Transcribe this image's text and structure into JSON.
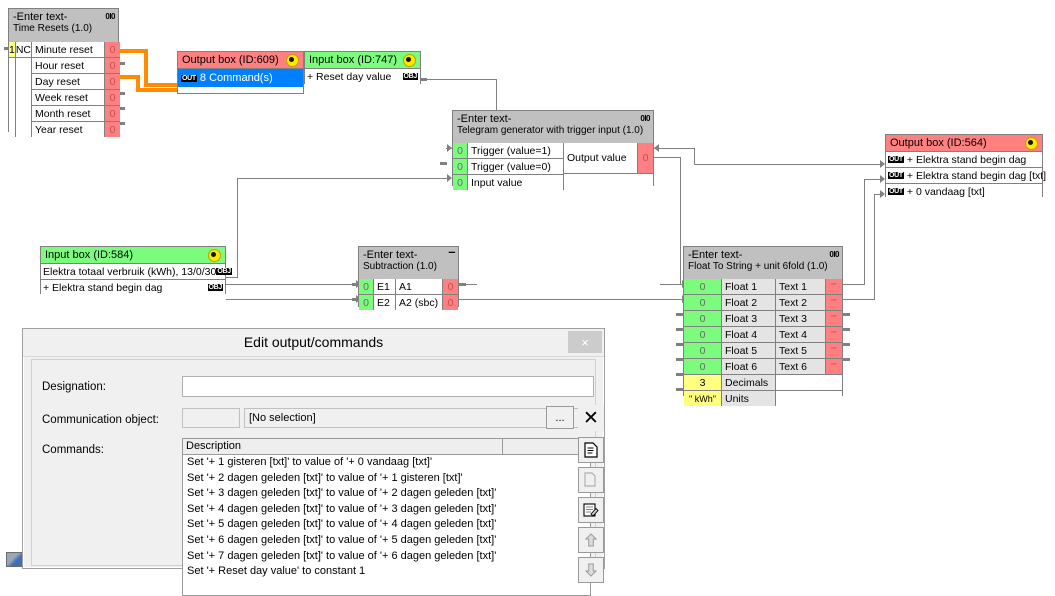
{
  "diagram": {
    "time_resets": {
      "header_line1": "-Enter text-",
      "header_line2": "Time Resets (1.0)",
      "badge": "0I0",
      "input_num": "1",
      "input_nc": "NC",
      "rows": [
        {
          "label": "Minute reset",
          "value": "0"
        },
        {
          "label": "Hour reset",
          "value": "0"
        },
        {
          "label": "Day reset",
          "value": "0"
        },
        {
          "label": "Week reset",
          "value": "0"
        },
        {
          "label": "Month reset",
          "value": "0"
        },
        {
          "label": "Year reset",
          "value": "0"
        }
      ]
    },
    "output_box_609": {
      "title": "Output box (ID:609)",
      "command_tag": "OUT",
      "command_text": "8 Command(s)"
    },
    "input_box_747": {
      "title": "Input box (ID:747)",
      "row_label": "+ Reset day value",
      "row_tag": "OBJ"
    },
    "telegram_generator": {
      "header_line1": "-Enter text-",
      "header_line2": "Telegram generator with trigger input (1.0)",
      "badge": "0I0",
      "inputs": [
        {
          "value": "0",
          "label": "Trigger (value=1)"
        },
        {
          "value": "0",
          "label": "Trigger (value=0)"
        },
        {
          "value": "0",
          "label": "Input value"
        }
      ],
      "output_label": "Output value",
      "output_value": "0"
    },
    "output_box_564": {
      "title": "Output box (ID:564)",
      "rows": [
        {
          "tag": "OUT",
          "label": "+ Elektra stand begin dag"
        },
        {
          "tag": "OUT",
          "label": "+ Elektra stand begin dag [txt]"
        },
        {
          "tag": "OUT",
          "label": "+ 0 vandaag [txt]"
        }
      ]
    },
    "input_box_584": {
      "title": "Input box (ID:584)",
      "rows": [
        {
          "label": "Elektra totaal verbruik (kWh), 13/0/30",
          "tag": "OBJ"
        },
        {
          "label": "+ Elektra stand begin dag",
          "tag": "OBJ"
        }
      ]
    },
    "subtraction": {
      "header_line1": "-Enter text-",
      "header_line2": "Subtraction (1.0)",
      "badge": "–",
      "rows": [
        {
          "value": "0",
          "in": "E1",
          "out": "A1",
          "outval": "0"
        },
        {
          "value": "0",
          "in": "E2",
          "out": "A2 (sbc)",
          "outval": "0"
        }
      ]
    },
    "float_to_string": {
      "header_line1": "-Enter text-",
      "header_line2": "Float To String + unit 6fold (1.0)",
      "badge": "0I0",
      "rows": [
        {
          "value": "0",
          "label": "Float 1",
          "text": "Text 1",
          "outval": "\"\""
        },
        {
          "value": "0",
          "label": "Float 2",
          "text": "Text 2",
          "outval": "\"\""
        },
        {
          "value": "0",
          "label": "Float 3",
          "text": "Text 3",
          "outval": "\"\""
        },
        {
          "value": "0",
          "label": "Float 4",
          "text": "Text 4",
          "outval": "\"\""
        },
        {
          "value": "0",
          "label": "Float 5",
          "text": "Text 5",
          "outval": "\"\""
        },
        {
          "value": "0",
          "label": "Float 6",
          "text": "Text 6",
          "outval": "\"\""
        }
      ],
      "decimals_value": "3",
      "decimals_label": "Decimals",
      "units_value": "\" kWh\"",
      "units_label": "Units"
    }
  },
  "dialog": {
    "title": "Edit output/commands",
    "close_label": "×",
    "designation_label": "Designation:",
    "designation_value": "",
    "designation_placeholder": "",
    "comm_object_label": "Communication object:",
    "comm_object_number": "",
    "comm_object_value": "[No selection]",
    "browse_label": "...",
    "clear_label": "✕",
    "commands_label": "Commands:",
    "list_header": [
      "Description",
      ""
    ],
    "commands": [
      "Set '+ 1 gisteren [txt]' to value of '+ 0 vandaag [txt]'",
      "Set '+ 2 dagen geleden [txt]' to value of '+ 1 gisteren [txt]'",
      "Set '+ 3 dagen geleden [txt]' to value of '+ 2 dagen geleden [txt]'",
      "Set '+ 4 dagen geleden [txt]' to value of '+ 3 dagen geleden [txt]'",
      "Set '+ 5 dagen geleden [txt]' to value of '+ 4 dagen geleden [txt]'",
      "Set '+ 6 dagen geleden [txt]' to value of '+ 5 dagen geleden [txt]'",
      "Set '+ 7 dagen geleden [txt]' to value of '+ 6 dagen geleden [txt]'",
      "Set '+ Reset day value' to constant 1"
    ],
    "side_buttons": [
      {
        "name": "new-command-button",
        "glyph": "☷"
      },
      {
        "name": "copy-command-button",
        "glyph": "❐"
      },
      {
        "name": "edit-command-button",
        "glyph": "✎"
      },
      {
        "name": "move-up-button",
        "glyph": "⇧"
      },
      {
        "name": "move-down-button",
        "glyph": "⇩"
      }
    ]
  },
  "colors": {
    "node_header": "#c0c0c0",
    "output_red": "#FF8080",
    "input_green": "#7CFC7C",
    "param_yellow": "#FFFF80",
    "command_blue": "#0080FF",
    "wire": "#808080",
    "trigger_wire": "#FF8C00"
  }
}
